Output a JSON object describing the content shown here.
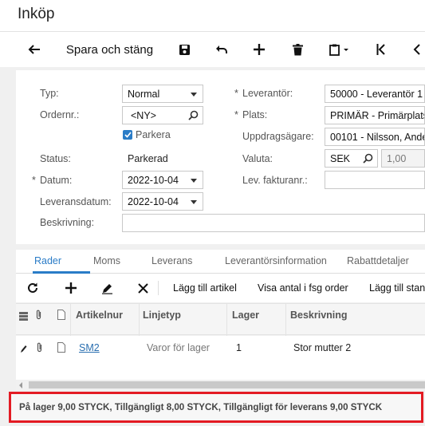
{
  "app": {
    "title": "Inköp"
  },
  "toolbar": {
    "save_close_label": "Spara och stäng",
    "icons": [
      "back-arrow-icon",
      "save-icon",
      "undo-icon",
      "add-icon",
      "delete-icon",
      "clipboard-icon",
      "first-record-icon",
      "previous-record-icon"
    ]
  },
  "form": {
    "type_label": "Typ:",
    "type_value": "Normal",
    "order_nr_label": "Ordernr.:",
    "order_nr_value": "<NY>",
    "park_label": "Parkera",
    "park_checked": true,
    "status_label": "Status:",
    "status_value": "Parkerad",
    "date_label": "Datum:",
    "date_value": "2022-10-04",
    "delivery_date_label": "Leveransdatum:",
    "delivery_date_value": "2022-10-04",
    "description_label": "Beskrivning:",
    "description_value": "",
    "supplier_label": "Leverantör:",
    "supplier_value": "50000 - Leverantör 1",
    "location_label": "Plats:",
    "location_value": "PRIMÄR - Primärplats",
    "owner_label": "Uppdragsägare:",
    "owner_value": "00101 - Nilsson, Ande",
    "currency_label": "Valuta:",
    "currency_value": "SEK",
    "currency_rate": "1,00",
    "supplier_invoice_label": "Lev. fakturanr.:",
    "supplier_invoice_value": ""
  },
  "tabs": [
    {
      "label": "Rader",
      "active": true
    },
    {
      "label": "Moms",
      "active": false
    },
    {
      "label": "Leverans",
      "active": false
    },
    {
      "label": "Leverantörsinformation",
      "active": false
    },
    {
      "label": "Rabattdetaljer",
      "active": false
    }
  ],
  "grid_toolbar": {
    "add_item_label": "Lägg till artikel",
    "show_qty_label": "Visa antal i fsg order",
    "add_std_label": "Lägg till stan"
  },
  "grid": {
    "columns": [
      "Artikelnur",
      "Linjetyp",
      "Lager",
      "Beskrivning"
    ],
    "rows": [
      {
        "item": "SM2",
        "line_type": "Varor för lager",
        "warehouse": "1",
        "description": "Stor mutter 2"
      }
    ]
  },
  "status_bar": {
    "text": "På lager 9,00 STYCK, Tillgängligt 8,00 STYCK, Tillgängligt för leverans 9,00 STYCK"
  },
  "colors": {
    "accent": "#2a7cc7",
    "highlight_border": "#e31b23"
  }
}
